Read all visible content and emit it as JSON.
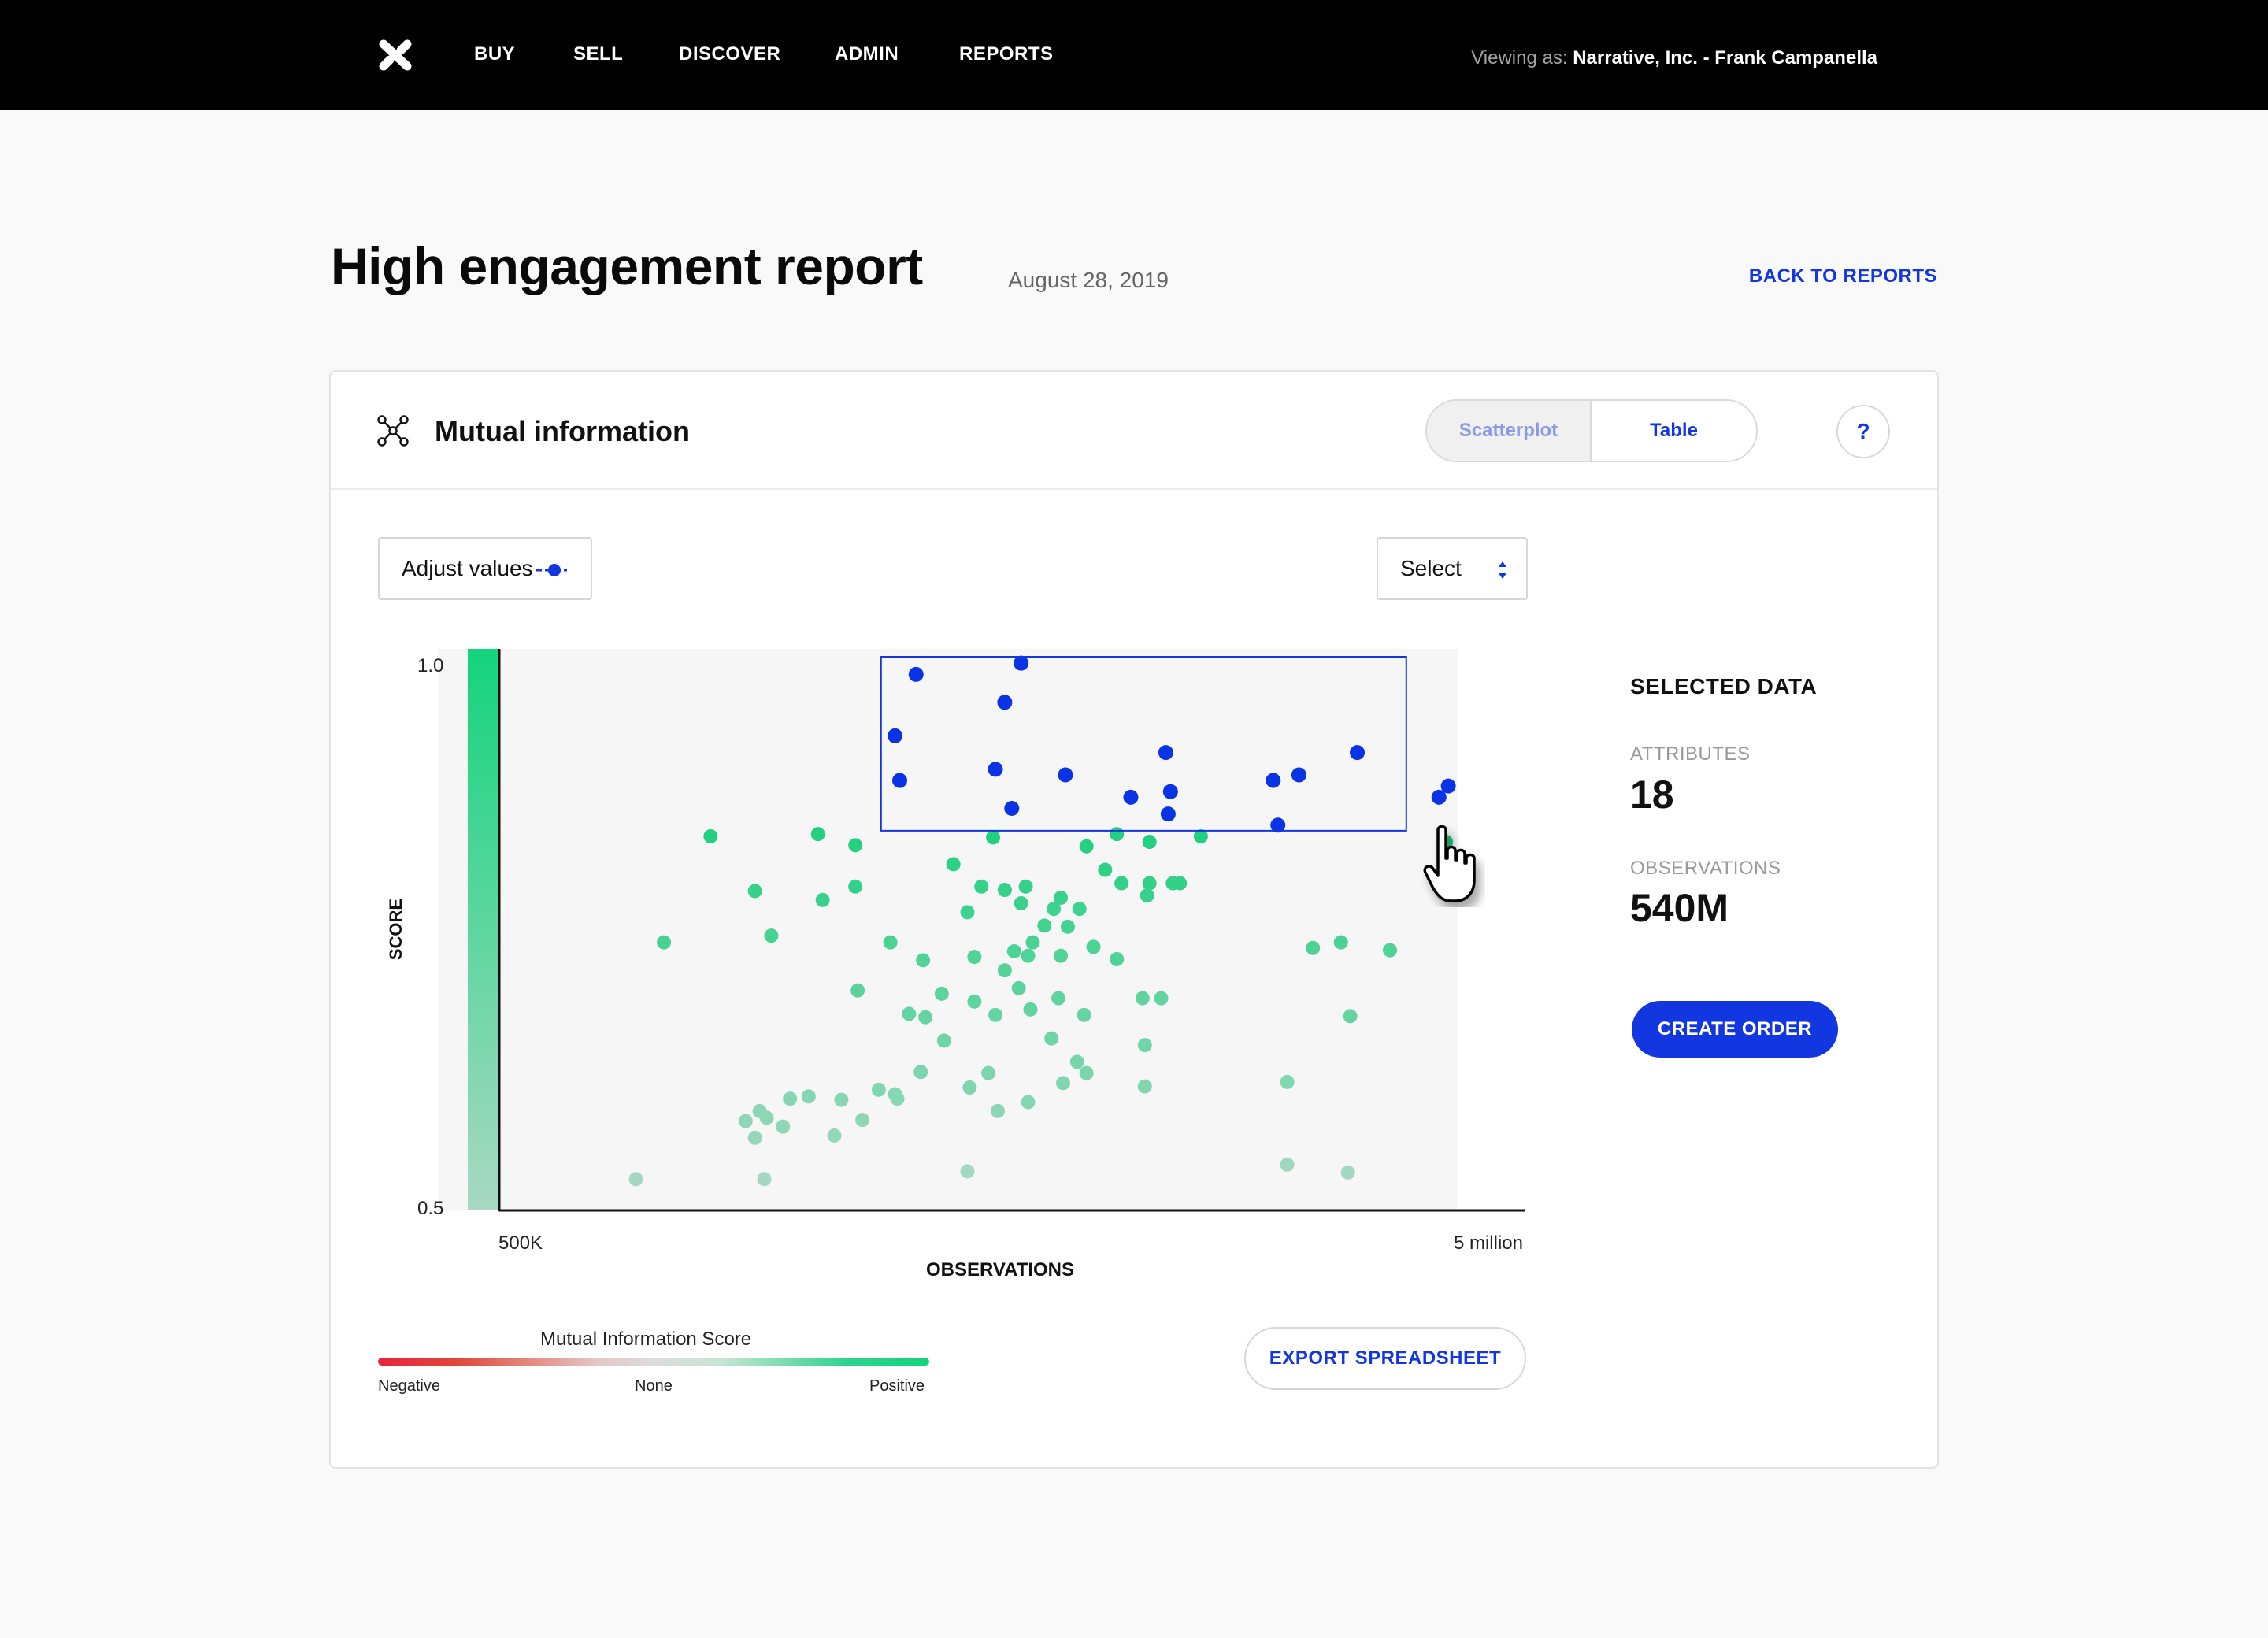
{
  "nav": {
    "items": [
      "BUY",
      "SELL",
      "DISCOVER",
      "ADMIN",
      "REPORTS"
    ],
    "viewing_label": "Viewing as:",
    "viewing_value": "Narrative, Inc. - Frank Campanella"
  },
  "header": {
    "title": "High engagement report",
    "date": "August 28, 2019",
    "back_link": "BACK TO REPORTS"
  },
  "card": {
    "title": "Mutual information",
    "icon": "network-icon",
    "toggle": {
      "scatter_label": "Scatterplot",
      "table_label": "Table",
      "active": "Scatterplot"
    },
    "help_label": "?",
    "adjust_label": "Adjust values",
    "select_label": "Select",
    "selected_panel": {
      "title": "SELECTED DATA",
      "attributes_label": "ATTRIBUTES",
      "attributes_value": "18",
      "observations_label": "OBSERVATIONS",
      "observations_value": "540M",
      "create_order_label": "CREATE ORDER"
    },
    "legend": {
      "title": "Mutual Information Score",
      "negative": "Negative",
      "none": "None",
      "positive": "Positive"
    },
    "export_label": "EXPORT SPREADSHEET"
  },
  "colors": {
    "accent": "#1236e0",
    "positive": "#14d47c",
    "negative": "#e8233f",
    "selected_point": "#0a33e6"
  },
  "chart_data": {
    "type": "scatter",
    "title": "",
    "xlabel": "OBSERVATIONS",
    "ylabel": "SCORE",
    "x_tick_labels": [
      "500K",
      "5 million"
    ],
    "y_tick_labels": [
      "1.0",
      "0.5"
    ],
    "xlim": [
      500000,
      5000000
    ],
    "ylim": [
      0.5,
      1.0
    ],
    "grid": false,
    "selection": {
      "x": [
        2250000,
        4500000
      ],
      "y": [
        0.84,
        1.0
      ]
    },
    "selected_points": [
      [
        2400000,
        0.98
      ],
      [
        2850000,
        0.99
      ],
      [
        2780000,
        0.955
      ],
      [
        2310000,
        0.925
      ],
      [
        2330000,
        0.885
      ],
      [
        2740000,
        0.895
      ],
      [
        3040000,
        0.89
      ],
      [
        3470000,
        0.91
      ],
      [
        3490000,
        0.875
      ],
      [
        3320000,
        0.87
      ],
      [
        3480000,
        0.855
      ],
      [
        2810000,
        0.86
      ],
      [
        3930000,
        0.885
      ],
      [
        4040000,
        0.89
      ],
      [
        4290000,
        0.91
      ],
      [
        4680000,
        0.88
      ],
      [
        4640000,
        0.87
      ],
      [
        3950000,
        0.845
      ]
    ],
    "points": [
      [
        1520000,
        0.835
      ],
      [
        1980000,
        0.837
      ],
      [
        2140000,
        0.827
      ],
      [
        2730000,
        0.834
      ],
      [
        3130000,
        0.826
      ],
      [
        3260000,
        0.837
      ],
      [
        3400000,
        0.83
      ],
      [
        3620000,
        0.835
      ],
      [
        4670000,
        0.83
      ],
      [
        2560000,
        0.81
      ],
      [
        3210000,
        0.805
      ],
      [
        1710000,
        0.786
      ],
      [
        2000000,
        0.778
      ],
      [
        2140000,
        0.79
      ],
      [
        2680000,
        0.79
      ],
      [
        2780000,
        0.787
      ],
      [
        2870000,
        0.79
      ],
      [
        3020000,
        0.78
      ],
      [
        3280000,
        0.793
      ],
      [
        3400000,
        0.793
      ],
      [
        3500000,
        0.793
      ],
      [
        3530000,
        0.793
      ],
      [
        3390000,
        0.782
      ],
      [
        2850000,
        0.775
      ],
      [
        2990000,
        0.77
      ],
      [
        3100000,
        0.77
      ],
      [
        2620000,
        0.767
      ],
      [
        1320000,
        0.74
      ],
      [
        1780000,
        0.746
      ],
      [
        2290000,
        0.74
      ],
      [
        2900000,
        0.74
      ],
      [
        2950000,
        0.755
      ],
      [
        3050000,
        0.754
      ],
      [
        3160000,
        0.736
      ],
      [
        2880000,
        0.728
      ],
      [
        3020000,
        0.728
      ],
      [
        2820000,
        0.732
      ],
      [
        2780000,
        0.715
      ],
      [
        2650000,
        0.727
      ],
      [
        2430000,
        0.724
      ],
      [
        3260000,
        0.725
      ],
      [
        4100000,
        0.735
      ],
      [
        4220000,
        0.74
      ],
      [
        4430000,
        0.733
      ],
      [
        2150000,
        0.697
      ],
      [
        2510000,
        0.694
      ],
      [
        2840000,
        0.699
      ],
      [
        3010000,
        0.69
      ],
      [
        3370000,
        0.69
      ],
      [
        3450000,
        0.69
      ],
      [
        2650000,
        0.687
      ],
      [
        2440000,
        0.673
      ],
      [
        2370000,
        0.676
      ],
      [
        2740000,
        0.675
      ],
      [
        2890000,
        0.68
      ],
      [
        3120000,
        0.675
      ],
      [
        4260000,
        0.674
      ],
      [
        2520000,
        0.652
      ],
      [
        2980000,
        0.654
      ],
      [
        3380000,
        0.648
      ],
      [
        2420000,
        0.624
      ],
      [
        2710000,
        0.623
      ],
      [
        3090000,
        0.633
      ],
      [
        3130000,
        0.623
      ],
      [
        3030000,
        0.614
      ],
      [
        3380000,
        0.611
      ],
      [
        3990000,
        0.615
      ],
      [
        2310000,
        0.604
      ],
      [
        2630000,
        0.61
      ],
      [
        2880000,
        0.597
      ],
      [
        2240000,
        0.608
      ],
      [
        1940000,
        0.602
      ],
      [
        2080000,
        0.599
      ],
      [
        2320000,
        0.6
      ],
      [
        1860000,
        0.6
      ],
      [
        2750000,
        0.589
      ],
      [
        1730000,
        0.589
      ],
      [
        2170000,
        0.581
      ],
      [
        1760000,
        0.583
      ],
      [
        1830000,
        0.575
      ],
      [
        1670000,
        0.58
      ],
      [
        2050000,
        0.567
      ],
      [
        1710000,
        0.565
      ],
      [
        3990000,
        0.541
      ],
      [
        4250000,
        0.534
      ],
      [
        2620000,
        0.535
      ],
      [
        1200000,
        0.528
      ],
      [
        1750000,
        0.528
      ]
    ]
  }
}
